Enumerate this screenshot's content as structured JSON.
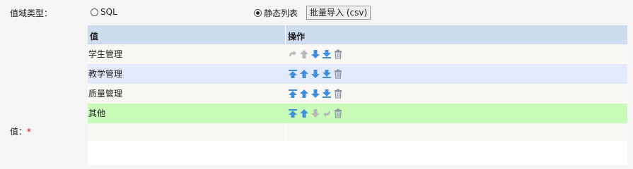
{
  "form": {
    "domain_type_label": "值域类型：",
    "value_label": "值：",
    "required_mark": "*"
  },
  "domain_type": {
    "options": [
      {
        "label": "SQL",
        "checked": false
      },
      {
        "label": "静态列表",
        "checked": true
      }
    ],
    "import_button_label": "批量导入 (csv)"
  },
  "table": {
    "headers": {
      "value": "值",
      "operation": "操作"
    },
    "rows": [
      {
        "value": "学生管理",
        "row_bg": "#f9f8f4",
        "ops": {
          "top": false,
          "up": false,
          "down": true,
          "bottom": true,
          "delete": true
        }
      },
      {
        "value": "教学管理",
        "row_bg": "#e4eafd",
        "ops": {
          "top": true,
          "up": true,
          "down": true,
          "bottom": true,
          "delete": true
        }
      },
      {
        "value": "质量管理",
        "row_bg": "#f9f8f4",
        "ops": {
          "top": true,
          "up": true,
          "down": true,
          "bottom": true,
          "delete": true
        }
      },
      {
        "value": "其他",
        "row_bg": "#c9fcb9",
        "ops": {
          "top": true,
          "up": true,
          "down": false,
          "bottom": false,
          "delete": true
        }
      }
    ]
  },
  "colors": {
    "header_bg": "#cfdcf0",
    "icon_active": "#3f8fe0",
    "icon_disabled": "#b8b8b8",
    "delete_icon": "#8a97a8"
  },
  "icons": {
    "top": "move-top-icon",
    "up": "move-up-icon",
    "down": "move-down-icon",
    "bottom": "move-bottom-icon",
    "delete": "trash-icon",
    "disabled_top": "curved-arrow-disabled-icon"
  }
}
